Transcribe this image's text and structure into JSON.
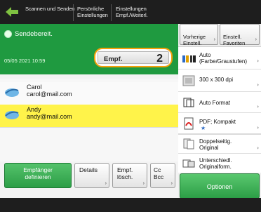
{
  "header": {
    "items": [
      {
        "label": "Scannen und\nSenden"
      },
      {
        "label": "Persönliche\nEinstellungen"
      },
      {
        "label": "Einstellungen\nEmpf./Weiterl."
      }
    ]
  },
  "status": {
    "text": "Sendebereit.",
    "datetime": "05/05 2021 10:59",
    "recipient_button_label": "Empf.",
    "recipient_count": "2"
  },
  "recipients": [
    {
      "name": "Carol",
      "email": "carol@mail.com",
      "selected": false
    },
    {
      "name": "Andy",
      "email": "andy@mail.com",
      "selected": true
    }
  ],
  "bottom_buttons": {
    "specify": "Empfänger\ndefinieren",
    "details": "Details",
    "delete": "Empf.\nlösch.",
    "cc": "Cc\nBcc"
  },
  "right_panel": {
    "prev_settings": "Vorherige\nEinstell.",
    "favorites": "Einstell.\nFavoriten",
    "color_mode": "Auto\n(Farbe/Graustufen)",
    "resolution": "300 x 300 dpi",
    "format": "Auto Format",
    "file_type": "PDF; Kompakt",
    "duplex": "Doppelseitig.\nOriginal",
    "mixed": "Unterschiedl.\nOriginalform.",
    "options": "Optionen"
  },
  "colors": {
    "status_green": "#1f9a40",
    "highlight_yellow": "#fff34a",
    "focus_orange": "#f5a00a"
  }
}
